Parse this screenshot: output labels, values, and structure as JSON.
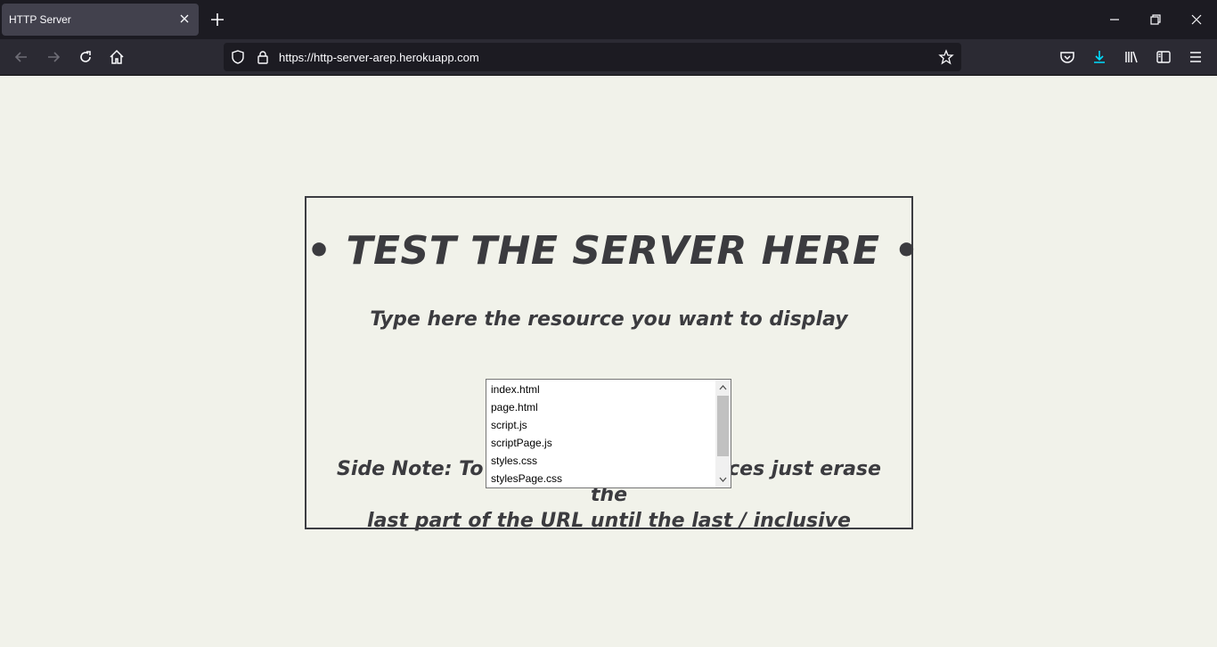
{
  "browser": {
    "tab_title": "HTTP Server",
    "url": "https://http-server-arep.herokuapp.com",
    "icons": {
      "tab_close": "close-icon",
      "new_tab": "plus-icon",
      "minimize": "minimize-icon",
      "restore": "restore-icon",
      "close_window": "close-icon",
      "back": "arrow-left-icon",
      "forward": "arrow-right-icon",
      "reload": "reload-icon",
      "home": "home-icon",
      "tracking": "shield-icon",
      "lock": "lock-icon",
      "bookmark": "star-icon",
      "pocket": "pocket-icon",
      "downloads": "download-icon",
      "library": "library-icon",
      "sidebar": "sidebar-icon",
      "menu": "hamburger-menu-icon"
    },
    "accent_color": "#00ddff"
  },
  "page": {
    "heading": "• TEST THE SERVER HERE •",
    "subheading": "Type here the resource you want to display",
    "side_note_line1": "Side Note: To go back to the resources just erase the",
    "side_note_line2": "last part of the URL until the last / inclusive",
    "resource_options": [
      "index.html",
      "page.html",
      "script.js",
      "scriptPage.js",
      "styles.css",
      "stylesPage.css"
    ],
    "colors": {
      "background": "#f1f2ea",
      "text": "#3b3b3f",
      "border": "#3c3d42"
    }
  }
}
